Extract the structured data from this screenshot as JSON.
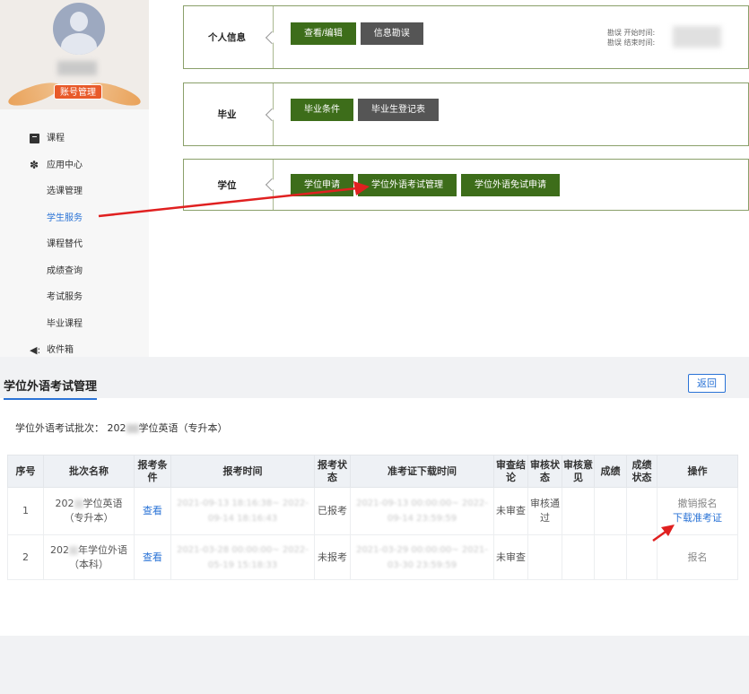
{
  "sidebar": {
    "account_button": "账号管理",
    "items": [
      {
        "label": "课程",
        "icon": "book-icon",
        "main": true
      },
      {
        "label": "应用中心",
        "icon": "apps-icon",
        "main": true
      },
      {
        "label": "选课管理"
      },
      {
        "label": "学生服务",
        "active": true
      },
      {
        "label": "课程替代"
      },
      {
        "label": "成绩查询"
      },
      {
        "label": "考试服务"
      },
      {
        "label": "毕业课程"
      },
      {
        "label": "收件箱",
        "icon": "mailbox-icon",
        "main": true
      }
    ]
  },
  "panels": {
    "personal": {
      "title": "个人信息",
      "buttons": [
        "查看/编辑",
        "信息勘误"
      ],
      "info_start": "勘误 开始时间:",
      "info_end": "勘误 结束时间:"
    },
    "graduation": {
      "title": "毕业",
      "buttons": [
        "毕业条件",
        "毕业生登记表"
      ]
    },
    "degree": {
      "title": "学位",
      "buttons": [
        "学位申请",
        "学位外语考试管理",
        "学位外语免试申请"
      ]
    }
  },
  "exam": {
    "title": "学位外语考试管理",
    "back_button": "返回",
    "batch_prefix": "学位外语考试批次：",
    "batch_year": "202",
    "batch_suffix": "学位英语（专升本）",
    "columns": [
      "序号",
      "批次名称",
      "报考条件",
      "报考时间",
      "报考状态",
      "准考证下载时间",
      "审查结论",
      "审核状态",
      "审核意见",
      "成绩",
      "成绩状态",
      "操作"
    ],
    "rows": [
      {
        "index": "1",
        "name_a": "202",
        "name_b": "学位英语",
        "name_c": "（专升本）",
        "condition": "查看",
        "time": "2021-09-13 18:16:38~ 2022-09-14 18:16:43",
        "status": "已报考",
        "ticket_time": "2021-09-13 00:00:00~ 2022-09-14 23:59:59",
        "review": "未审查",
        "audit": "审核通过",
        "opinion": "",
        "score": "",
        "score_status": "",
        "op1": "撤销报名",
        "op2": "下载准考证"
      },
      {
        "index": "2",
        "name_a": "202",
        "name_b": "年学位外语",
        "name_c": "（本科）",
        "condition": "查看",
        "time": "2021-03-28 00:00:00~ 2022-05-19 15:18:33",
        "status": "未报考",
        "ticket_time": "2021-03-29 00:00:00~ 2021-03-30 23:59:59",
        "review": "未审查",
        "audit": "",
        "opinion": "",
        "score": "",
        "score_status": "",
        "op1": "报名",
        "op2": ""
      }
    ]
  },
  "colors": {
    "green_button": "#3d6d1a",
    "dark_button": "#555555",
    "link_blue": "#2a73d6",
    "account_orange": "#e85a2a",
    "arrow_red": "#e02020"
  }
}
